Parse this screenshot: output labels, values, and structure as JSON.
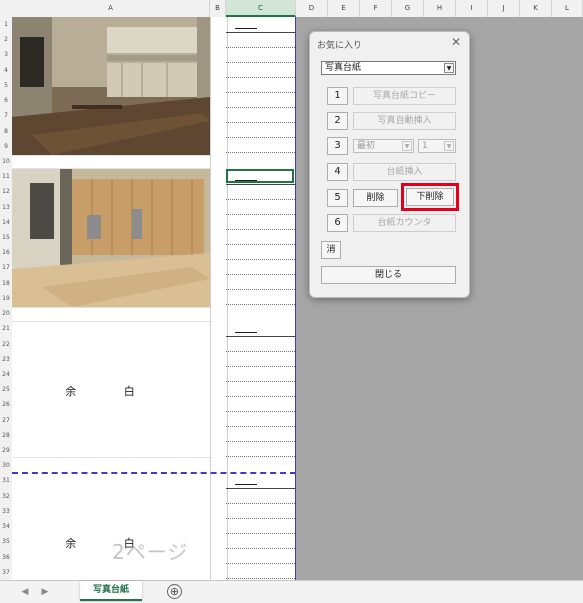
{
  "columns": [
    "A",
    "B",
    "C",
    "D",
    "E",
    "F",
    "G",
    "H",
    "I",
    "J",
    "K",
    "L"
  ],
  "rows": [
    "1",
    "2",
    "3",
    "4",
    "5",
    "6",
    "7",
    "8",
    "9",
    "10",
    "11",
    "12",
    "13",
    "14",
    "15",
    "16",
    "17",
    "18",
    "19",
    "20",
    "21",
    "22",
    "23",
    "24",
    "25",
    "26",
    "27",
    "28",
    "29",
    "30",
    "31",
    "32",
    "33",
    "34",
    "35",
    "36",
    "37"
  ],
  "sheet": {
    "blank_label": "余 白",
    "page_label": "2ページ",
    "photo1": "kitchen-photo",
    "photo2": "renovated-room-photo"
  },
  "tabs": {
    "active_sheet": "写真台紙",
    "add_icon": "⊕",
    "prev_icon": "◀",
    "next_icon": "▶"
  },
  "dialog": {
    "title": "お気に入り",
    "close": "✕",
    "template_select": "写真台紙",
    "rows": [
      {
        "num": "1",
        "label": "写真台紙コピー"
      },
      {
        "num": "2",
        "label": "写真自動挿入"
      },
      {
        "num": "3",
        "select_a": "最初",
        "select_b": "1"
      },
      {
        "num": "4",
        "label": "台紙挿入"
      },
      {
        "num": "5",
        "delete": "削除",
        "delete_below": "下削除"
      },
      {
        "num": "6",
        "label": "台紙カウンタ"
      }
    ],
    "clear": "消",
    "close_button": "閉じる"
  },
  "colors": {
    "highlight": "#e3001b",
    "page_break": "#3c3cc4",
    "excel_green": "#217346"
  }
}
